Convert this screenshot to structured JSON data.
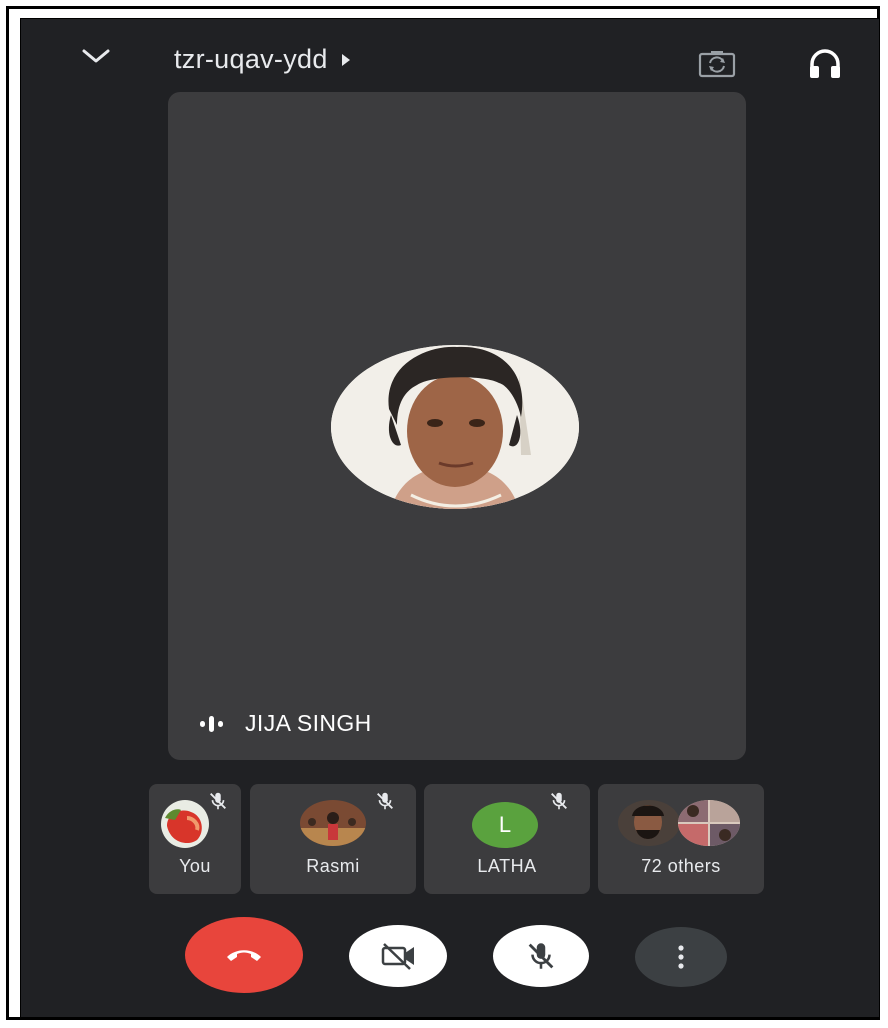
{
  "header": {
    "meeting_code": "tzr-uqav-ydd",
    "icons": [
      "chevron-down-icon",
      "play-arrow-icon",
      "switch-camera-icon",
      "headphones-icon"
    ]
  },
  "main_speaker": {
    "name": "JIJA SINGH",
    "speaking_indicator": "audio-bars-icon"
  },
  "participants": [
    {
      "label": "You",
      "muted": true
    },
    {
      "label": "Rasmi",
      "muted": true
    },
    {
      "label": "LATHA",
      "initial": "L",
      "avatar_color": "#5aa23e",
      "muted": true
    },
    {
      "label": "72 others"
    }
  ],
  "controls": {
    "end_call_color": "#e8453c",
    "icons": [
      "end-call-icon",
      "video-off-icon",
      "mic-off-icon",
      "more-options-icon"
    ]
  },
  "colors": {
    "background": "#202124",
    "tile": "#3c3c3e"
  }
}
